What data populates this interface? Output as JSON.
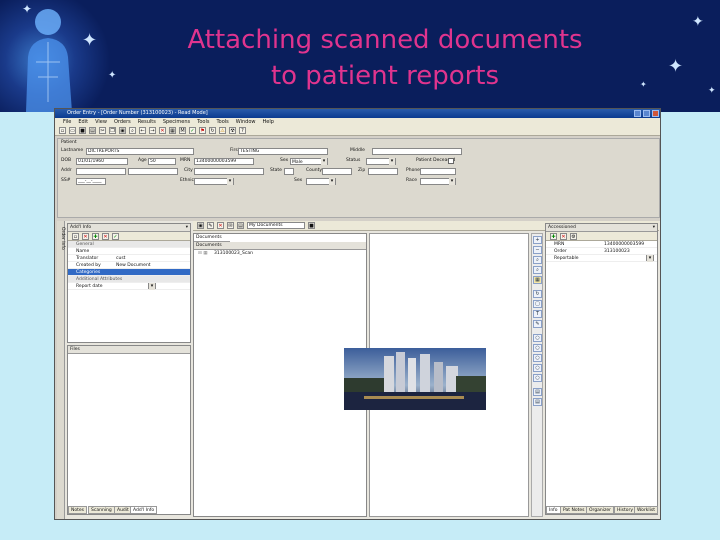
{
  "slide": {
    "title_line1": "Attaching scanned documents",
    "title_line2": "to patient reports"
  },
  "window": {
    "title": "Order Entry - [Order Number (313100023) - Read Mode]",
    "menu": [
      "File",
      "Edit",
      "View",
      "Orders",
      "Results",
      "Specimens",
      "Tools",
      "Tools",
      "Window",
      "Help"
    ]
  },
  "form": {
    "group_label": "Patient",
    "last_name_label": "Lastname",
    "last_name_value": "DICTREPORTS",
    "first_label": "First",
    "first_value": "TESTING",
    "middle_label": "Middle",
    "dob_label": "DOB",
    "dob_value": "01/01/1960",
    "age_label": "Age",
    "age_value": "50",
    "mrn_label": "MRN",
    "mrn_value": "13400000003599",
    "sex_label": "Sex",
    "sex_value": "Male",
    "status_label": "Status",
    "deceased_label": "Patient Deceased",
    "addr_label": "Addr",
    "city_label": "City",
    "state_label": "State",
    "country_label": "County",
    "zip_label": "Zip",
    "phone_label": "Phone",
    "ssn_label": "SS#",
    "ssn_value": "___-__-____",
    "ethnic_label": "Ethnic",
    "gender_label": "Sex",
    "race_label": "Race"
  },
  "left_panel": {
    "header": "Add'l Info",
    "rows": [
      {
        "k": "General",
        "v": "",
        "type": "grp"
      },
      {
        "k": "Name",
        "v": ""
      },
      {
        "k": "Translator",
        "v": "cust"
      },
      {
        "k": "Created by",
        "v": "New Document"
      },
      {
        "k": "Categories",
        "v": "",
        "type": "hl"
      },
      {
        "k": "Additional Attributes",
        "v": "",
        "type": "grp"
      },
      {
        "k": "Report date",
        "v": ""
      }
    ],
    "files_header": "Files",
    "bottom_tabs": [
      "Notes",
      "Scanning",
      "Audit",
      "Add'l Info"
    ]
  },
  "viewer_select": "My Documents",
  "doc_panel": {
    "header": "Documents",
    "tab": "Documents",
    "item": "313100023_Scan"
  },
  "right_panel": {
    "header": "Accessioned",
    "rows": [
      {
        "k": "MRN",
        "v": "13400000003599"
      },
      {
        "k": "Order",
        "v": "313100023"
      },
      {
        "k": "Reportable",
        "v": ""
      }
    ],
    "bottom_tabs": [
      "Info",
      "Pat Notes",
      "Organizer",
      "History",
      "Worklist"
    ]
  },
  "colors": {
    "banner": "#0a1e5c",
    "title": "#e0348e",
    "background": "#c6ecf7",
    "selection": "#316ac5"
  }
}
